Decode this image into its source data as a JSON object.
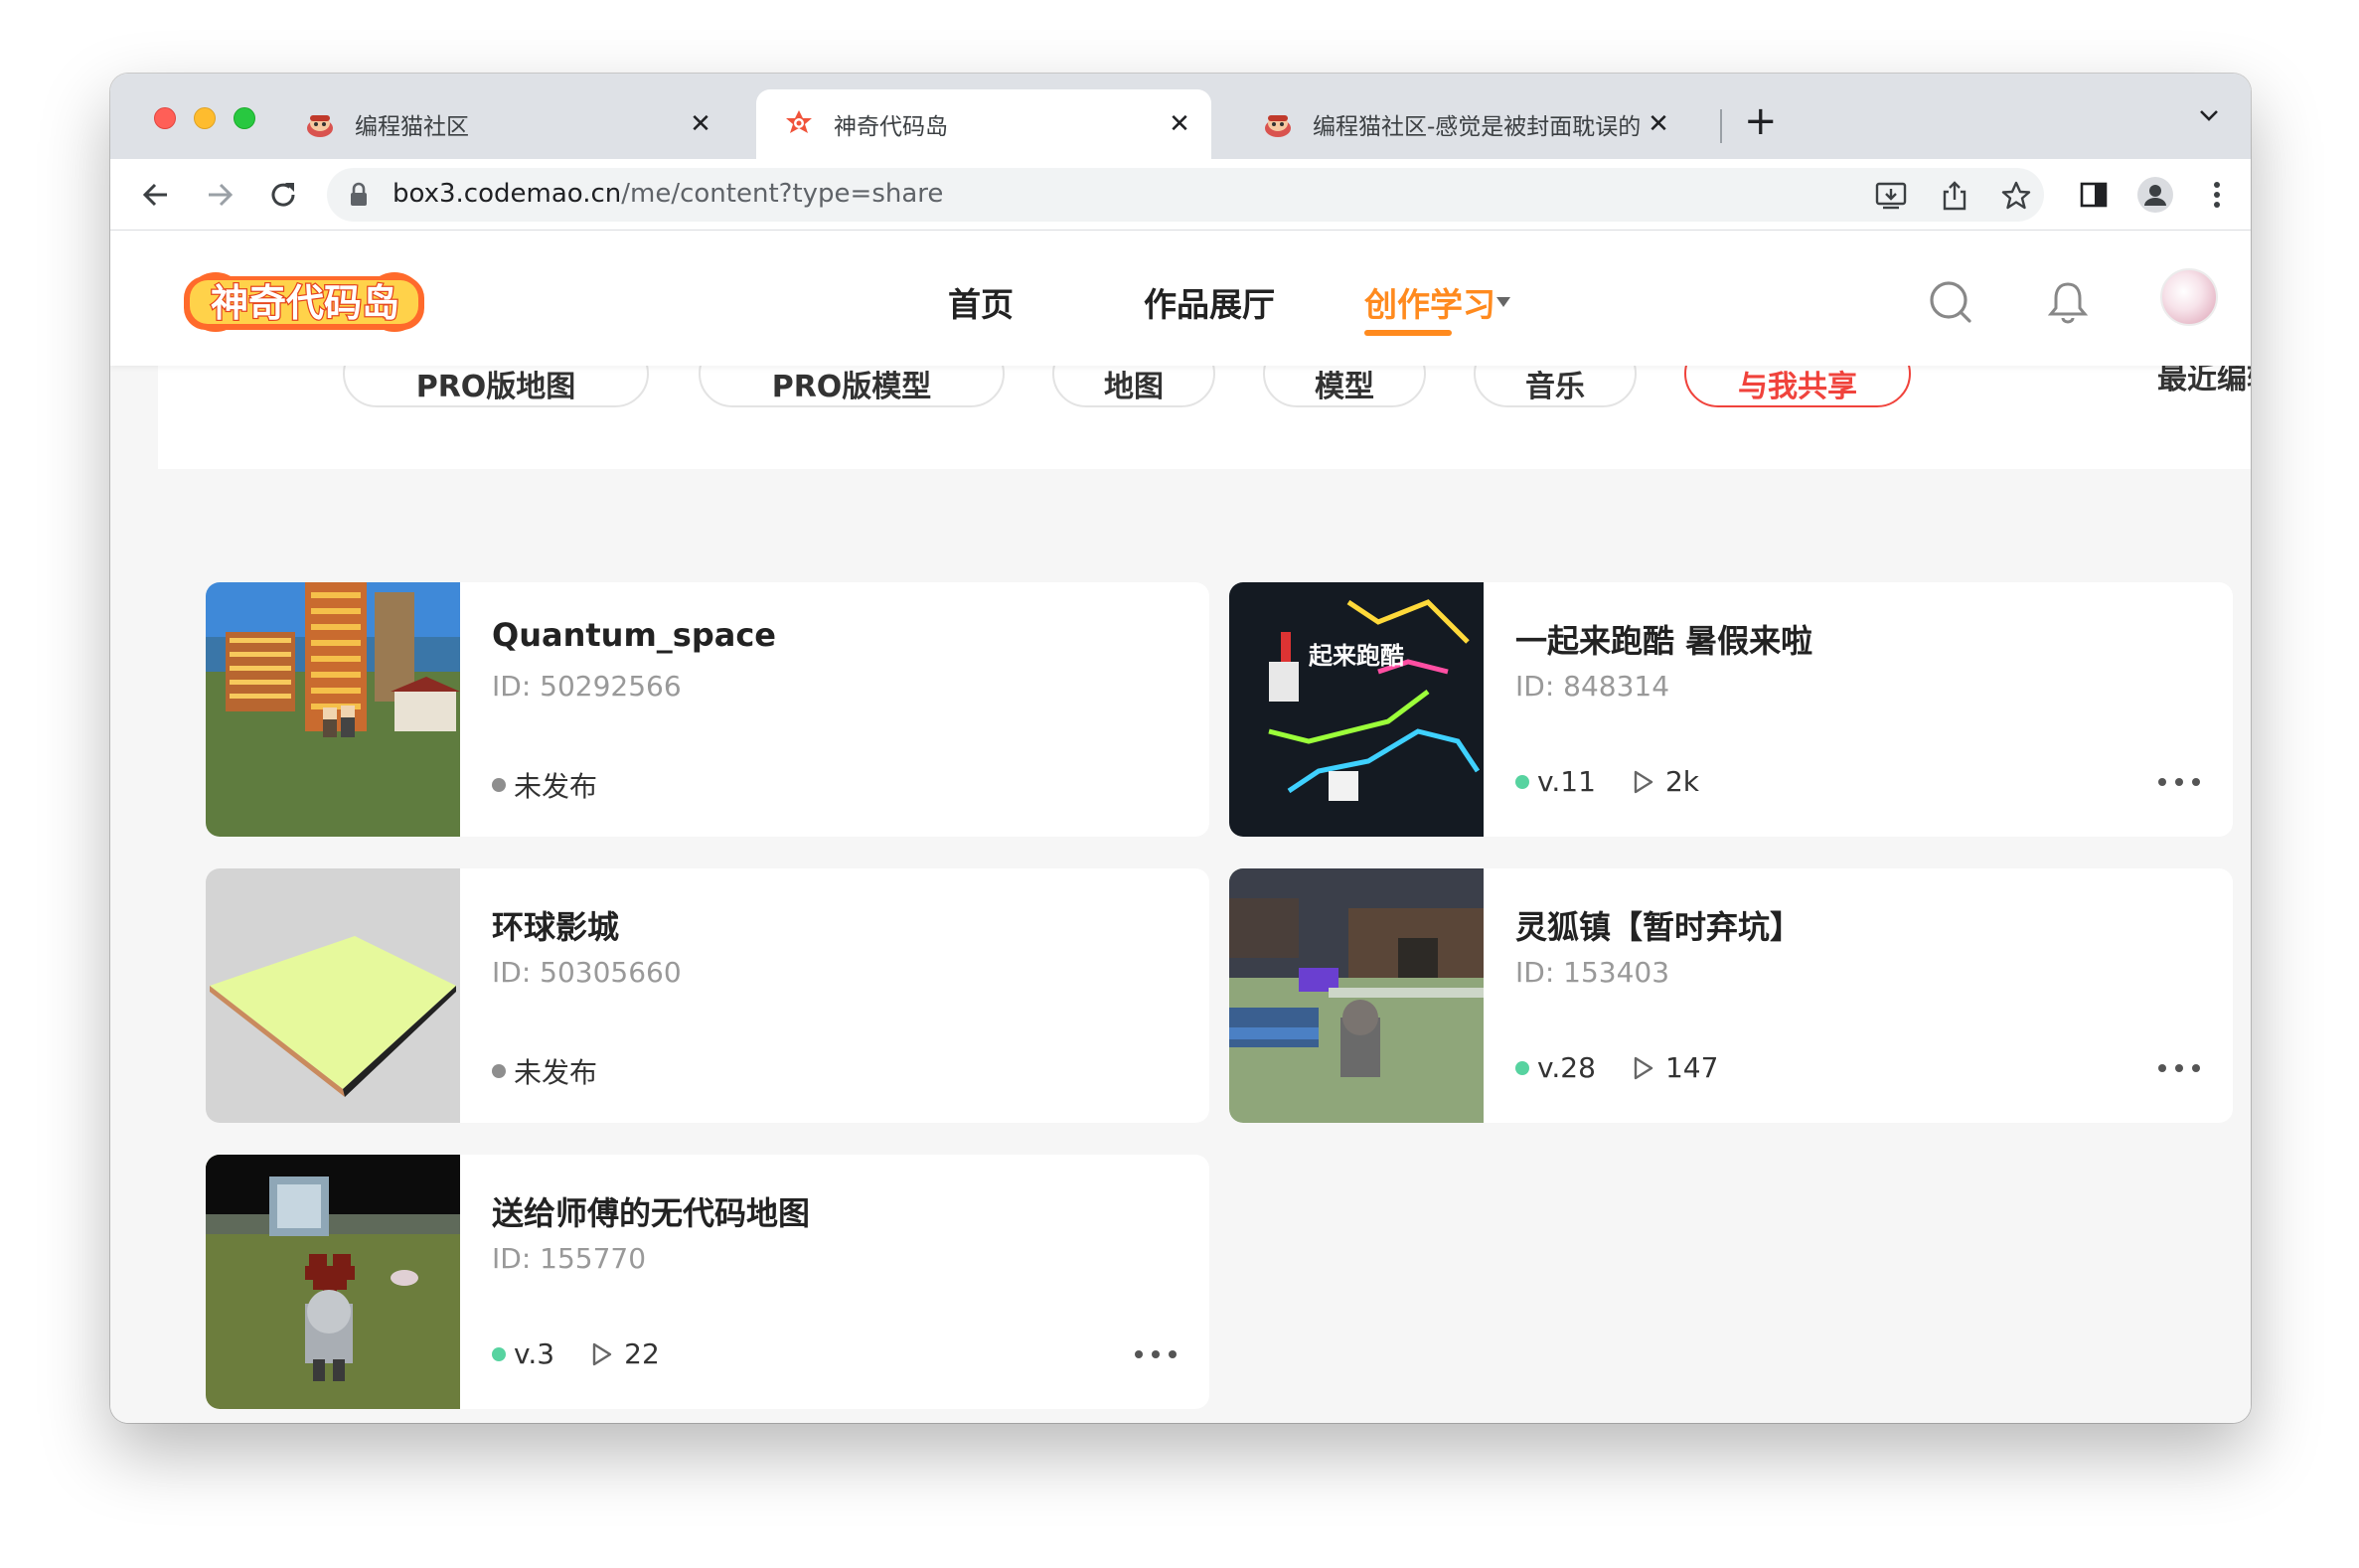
{
  "browser": {
    "tabs": [
      {
        "title": "编程猫社区",
        "active": false
      },
      {
        "title": "神奇代码岛",
        "active": true
      },
      {
        "title": "编程猫社区-感觉是被封面耽误的",
        "active": false
      }
    ],
    "close_glyph": "✕",
    "new_tab_glyph": "+",
    "url_host": "box3.codemao.cn",
    "url_path": "/me/content?type=share"
  },
  "site": {
    "logo_text": "神奇代码岛",
    "nav": [
      {
        "label": "首页",
        "active": false
      },
      {
        "label": "作品展厅",
        "active": false
      },
      {
        "label": "创作学习",
        "active": true
      }
    ],
    "accent_color": "#ff8a1e"
  },
  "filters": {
    "chips": [
      "PRO版地图",
      "PRO版模型",
      "地图",
      "模型",
      "音乐",
      "与我共享"
    ],
    "sort_label": "最近编辑"
  },
  "works": [
    {
      "title": "Quantum_space",
      "id": "ID: 50292566",
      "state": "未发布",
      "version": "",
      "plays": "",
      "thumb": "city"
    },
    {
      "title": "一起来跑酷 暑假来啦",
      "id": "ID: 848314",
      "state": "",
      "version": "v.11",
      "plays": "2k",
      "thumb": "parkour"
    },
    {
      "title": "环球影城",
      "id": "ID: 50305660",
      "state": "未发布",
      "version": "",
      "plays": "",
      "thumb": "plane"
    },
    {
      "title": "灵狐镇【暂时弃坑】",
      "id": "ID: 153403",
      "state": "",
      "version": "v.28",
      "plays": "147",
      "thumb": "town"
    },
    {
      "title": "送给师傅的无代码地图",
      "id": "ID: 155770",
      "state": "",
      "version": "v.3",
      "plays": "22",
      "thumb": "heart"
    }
  ],
  "icons": {
    "tab_favicon": "codemao-favicon-icon",
    "back": "back-arrow-icon",
    "forward": "forward-arrow-icon",
    "reload": "reload-icon",
    "lock": "lock-icon",
    "install": "install-app-icon",
    "share": "share-icon",
    "bookmark": "star-icon",
    "sidepanel": "side-panel-icon",
    "profile": "profile-icon",
    "menu": "kebab-menu-icon",
    "search": "search-icon",
    "bell": "bell-icon",
    "play": "play-icon",
    "more": "more-dots-icon"
  }
}
